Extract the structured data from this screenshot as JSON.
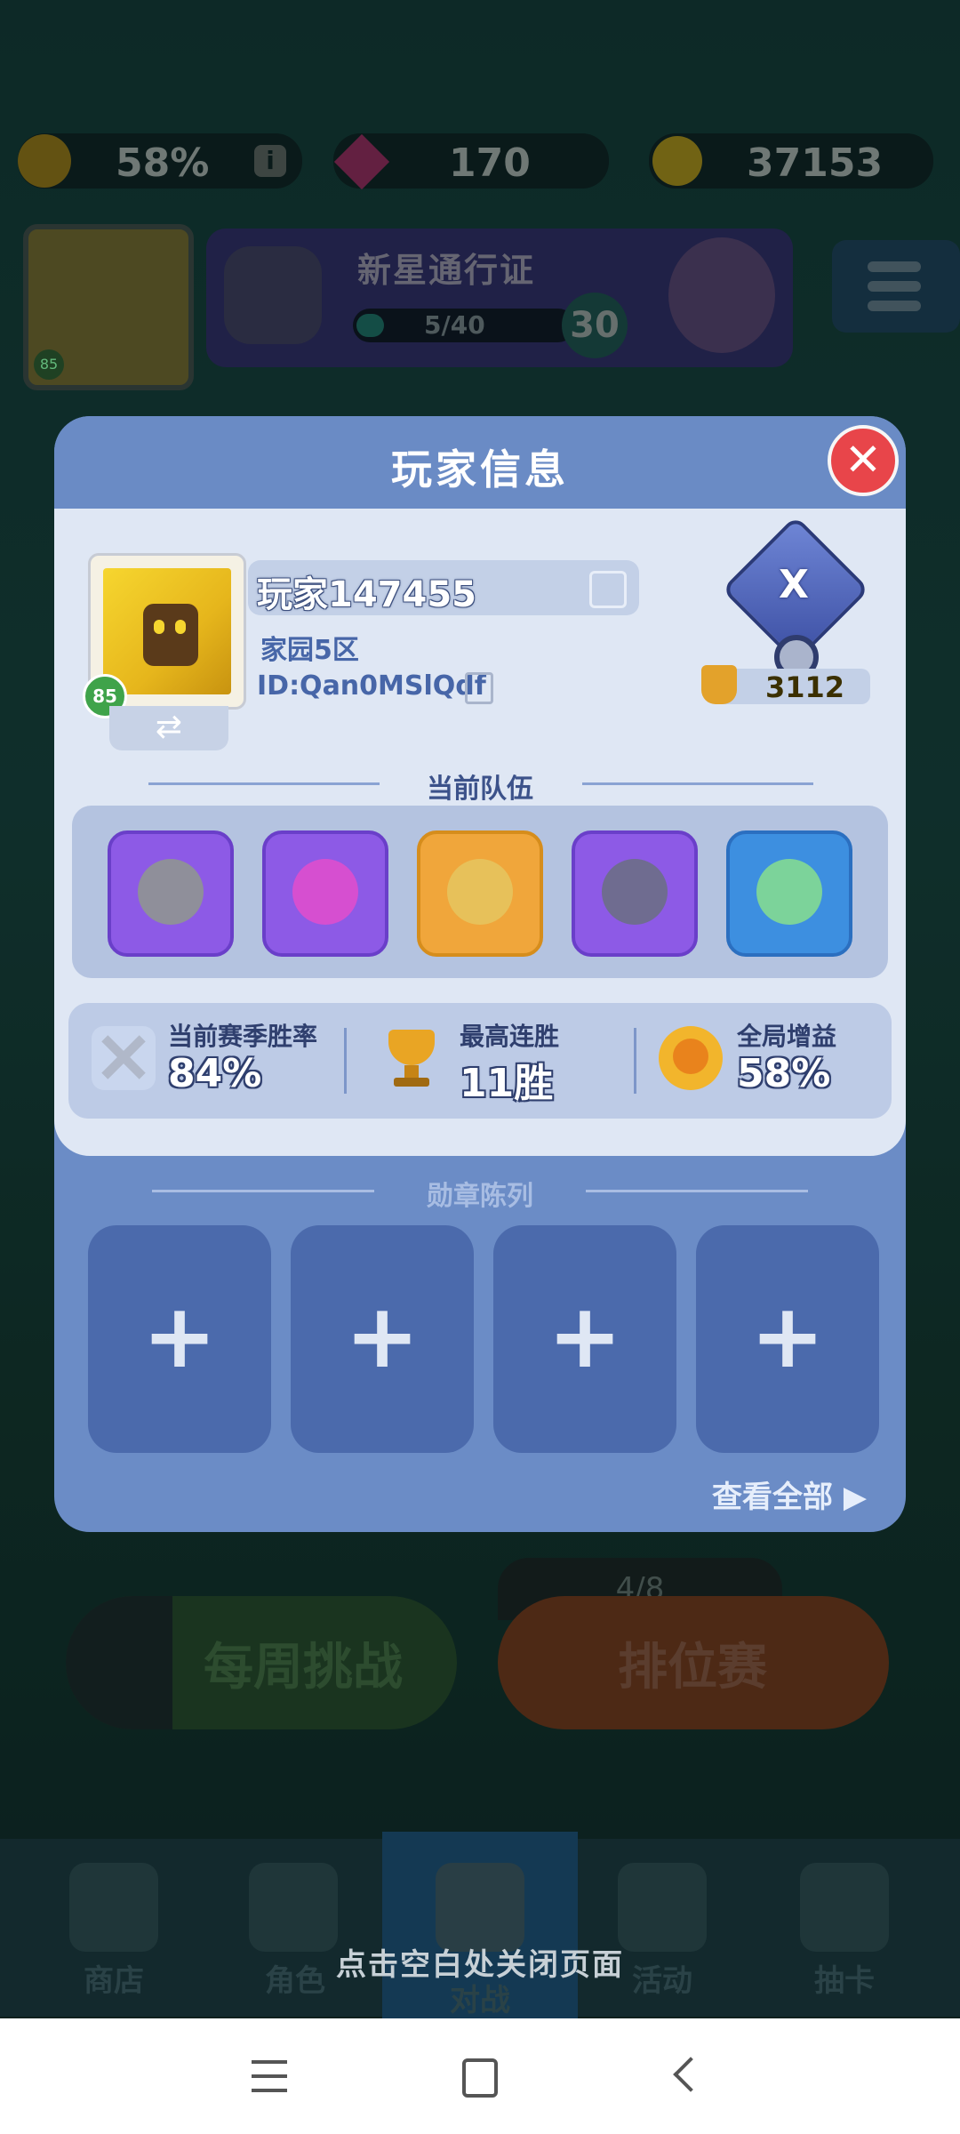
{
  "top_bar": {
    "boost_percent": "58%",
    "gems": "170",
    "coins": "37153"
  },
  "profile_mini": {
    "level": "85"
  },
  "pass": {
    "title": "新星通行证",
    "progress": "5/40",
    "progress_fraction": 0.125,
    "level": "30"
  },
  "modal": {
    "title": "玩家信息",
    "player": {
      "name": "玩家147455",
      "server": "家园5区",
      "id": "ID:Qan0MSlQdf",
      "level": "85",
      "rank_letter": "X",
      "trophies": "3112"
    },
    "team_section_title": "当前队伍",
    "team": [
      {
        "icon": "knight-hero-icon",
        "color": "#8f8f9a"
      },
      {
        "icon": "pink-brute-hero-icon",
        "color": "#d64fd0"
      },
      {
        "icon": "blonde-warrior-hero-icon",
        "color": "#e7a23a"
      },
      {
        "icon": "dark-knight-hero-icon",
        "color": "#6f6c90"
      },
      {
        "icon": "green-fairy-hero-icon",
        "color": "#7cd39a"
      }
    ],
    "stats": [
      {
        "icon": "crossed-swords-icon",
        "label": "当前赛季胜率",
        "value": "84%"
      },
      {
        "icon": "trophy-icon",
        "label": "最高连胜",
        "value": "11胜"
      },
      {
        "icon": "boost-icon",
        "label": "全局增益",
        "value": "58%"
      }
    ],
    "medal_section_title": "勋章陈列",
    "medal_slots": [
      "+",
      "+",
      "+",
      "+"
    ],
    "view_all": "查看全部"
  },
  "background": {
    "weekly_challenge": "每周挑战",
    "ranked_progress": "4/8",
    "ranked": "排位赛"
  },
  "bottom_nav": [
    "商店",
    "角色",
    "对战",
    "活动",
    "抽卡"
  ],
  "close_hint": "点击空白处关闭页面"
}
